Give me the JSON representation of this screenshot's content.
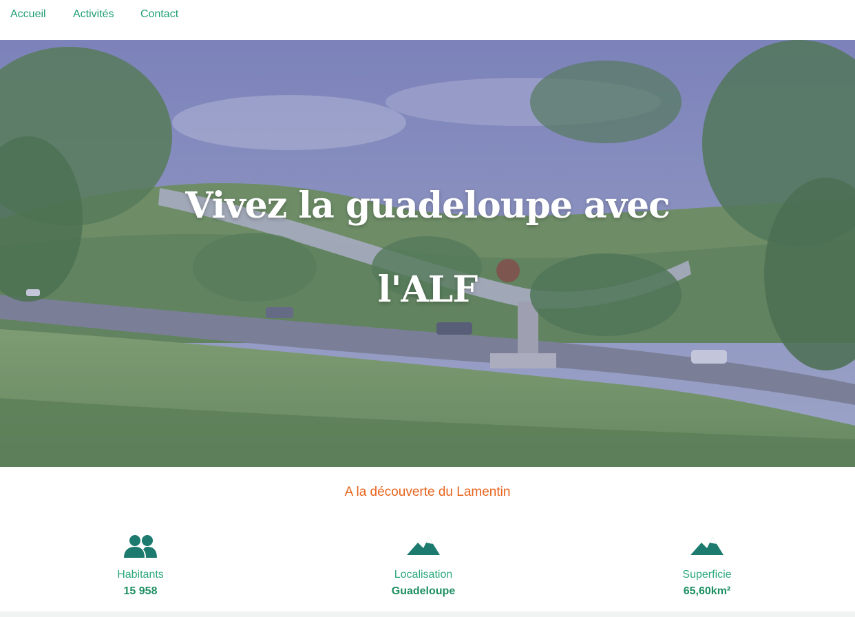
{
  "nav": {
    "items": [
      {
        "label": "Accueil"
      },
      {
        "label": "Activités"
      },
      {
        "label": "Contact"
      }
    ]
  },
  "hero": {
    "title_line1": "Vivez la guadeloupe avec",
    "title_line2": "l'ALF"
  },
  "section": {
    "title": "A la découverte du Lamentin"
  },
  "stats": [
    {
      "icon": "users-icon",
      "label": "Habitants",
      "value": "15 958"
    },
    {
      "icon": "mountain-icon",
      "label": "Localisation",
      "value": "Guadeloupe"
    },
    {
      "icon": "mountain-icon",
      "label": "Superficie",
      "value": "65,60km²"
    }
  ],
  "colors": {
    "accent_green": "#1e9e73",
    "icon_teal": "#1c7a6e",
    "heading_orange": "#e8641c"
  }
}
